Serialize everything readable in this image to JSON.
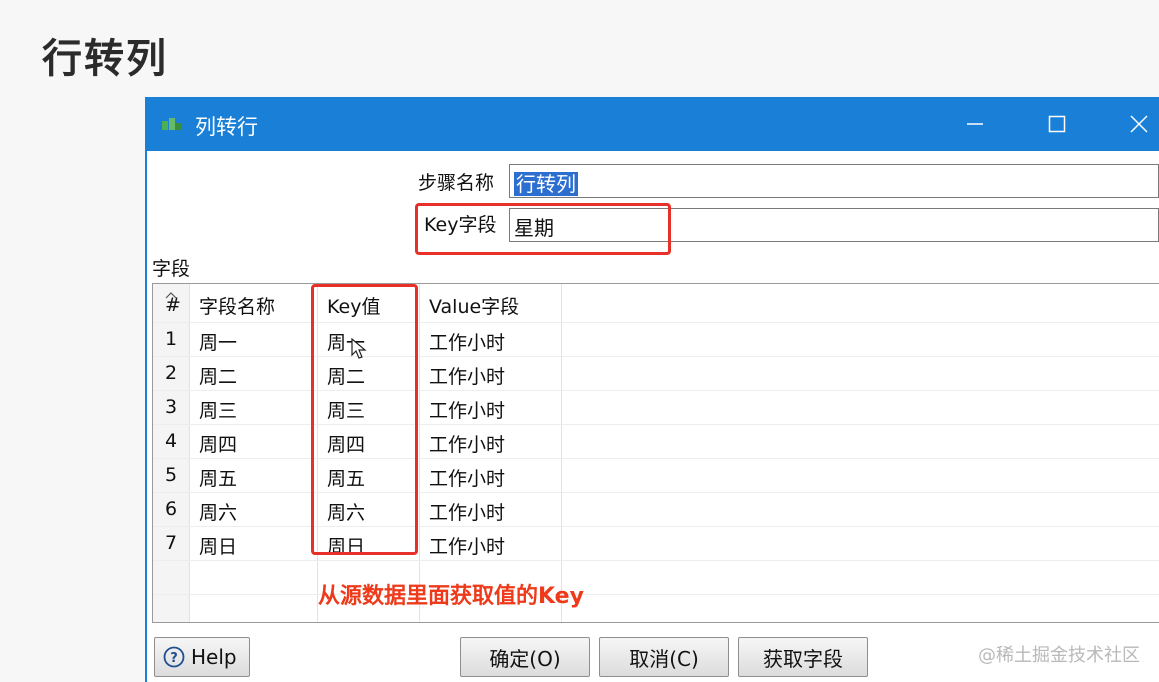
{
  "slide": {
    "title": "行转列"
  },
  "window": {
    "title": "列转行",
    "app_icon": "spoon-step-icon",
    "controls": [
      "minimize-icon",
      "maximize-icon",
      "close-icon"
    ]
  },
  "form": {
    "step_name_label": "步骤名称",
    "step_name_value": "行转列",
    "key_field_label": "Key字段",
    "key_field_value": "星期"
  },
  "fields_section_label": "字段",
  "table": {
    "columns": [
      "#",
      "字段名称",
      "Key值",
      "Value字段"
    ],
    "rows": [
      {
        "num": "1",
        "name": "周一",
        "key": "周一",
        "value": "工作小时"
      },
      {
        "num": "2",
        "name": "周二",
        "key": "周二",
        "value": "工作小时"
      },
      {
        "num": "3",
        "name": "周三",
        "key": "周三",
        "value": "工作小时"
      },
      {
        "num": "4",
        "name": "周四",
        "key": "周四",
        "value": "工作小时"
      },
      {
        "num": "5",
        "name": "周五",
        "key": "周五",
        "value": "工作小时"
      },
      {
        "num": "6",
        "name": "周六",
        "key": "周六",
        "value": "工作小时"
      },
      {
        "num": "7",
        "name": "周日",
        "key": "周日",
        "value": "工作小时"
      }
    ]
  },
  "annotation": {
    "text": "从源数据里面获取值的Key",
    "color": "#ee3a1a"
  },
  "buttons": {
    "help": "Help",
    "ok": "确定(O)",
    "cancel": "取消(C)",
    "get_fields": "获取字段"
  },
  "watermark": "@稀土掘金技术社区",
  "colors": {
    "titlebar": "#1a7fd6",
    "highlight_box": "#e8302a",
    "selection": "#2d6fd0"
  }
}
